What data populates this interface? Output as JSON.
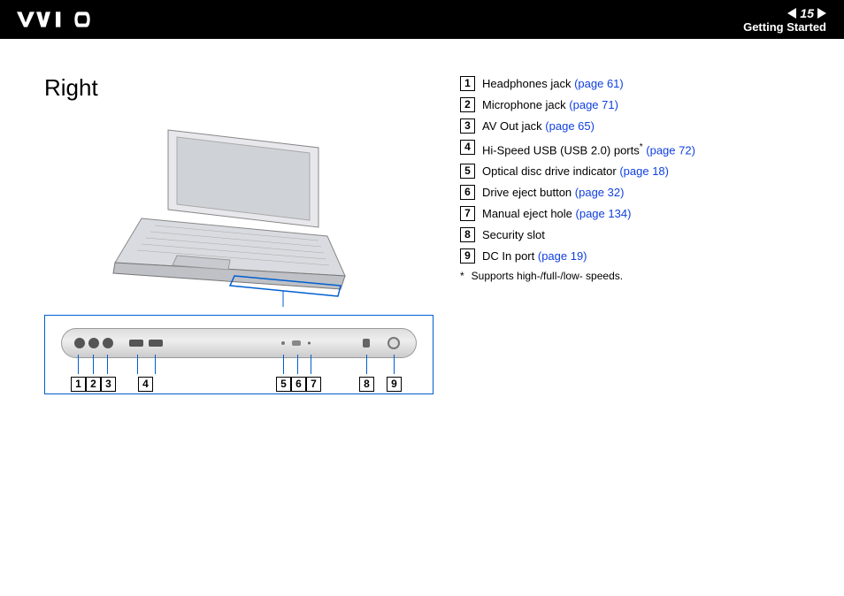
{
  "header": {
    "page_number": "15",
    "section": "Getting Started"
  },
  "title": "Right",
  "items": [
    {
      "num": "1",
      "text": "Headphones jack ",
      "link": "(page 61)"
    },
    {
      "num": "2",
      "text": "Microphone jack ",
      "link": "(page 71)"
    },
    {
      "num": "3",
      "text": "AV Out jack ",
      "link": "(page 65)"
    },
    {
      "num": "4",
      "text": "Hi-Speed USB (USB 2.0) ports",
      "sup": "*",
      "text2": " ",
      "link": "(page 72)"
    },
    {
      "num": "5",
      "text": "Optical disc drive indicator ",
      "link": "(page 18)"
    },
    {
      "num": "6",
      "text": "Drive eject button ",
      "link": "(page 32)"
    },
    {
      "num": "7",
      "text": "Manual eject hole ",
      "link": "(page 134)"
    },
    {
      "num": "8",
      "text": "Security slot",
      "link": ""
    },
    {
      "num": "9",
      "text": "DC In port ",
      "link": "(page 19)"
    }
  ],
  "footnote": {
    "mark": "*",
    "text": "Supports high-/full-/low- speeds."
  },
  "callouts": [
    "1",
    "2",
    "3",
    "4",
    "5",
    "6",
    "7",
    "8",
    "9"
  ]
}
